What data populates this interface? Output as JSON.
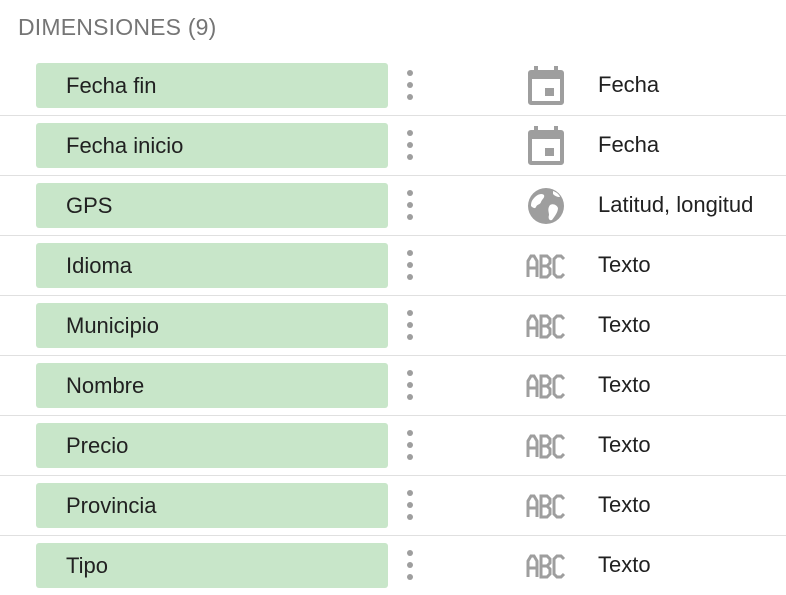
{
  "panel": {
    "title": "DIMENSIONES (9)"
  },
  "rows": [
    {
      "name": "Fecha fin",
      "type": "Fecha",
      "icon": "calendar-icon"
    },
    {
      "name": "Fecha inicio",
      "type": "Fecha",
      "icon": "calendar-icon"
    },
    {
      "name": "GPS",
      "type": "Latitud, longitud",
      "icon": "globe-icon"
    },
    {
      "name": "Idioma",
      "type": "Texto",
      "icon": "abc-text-icon"
    },
    {
      "name": "Municipio",
      "type": "Texto",
      "icon": "abc-text-icon"
    },
    {
      "name": "Nombre",
      "type": "Texto",
      "icon": "abc-text-icon"
    },
    {
      "name": "Precio",
      "type": "Texto",
      "icon": "abc-text-icon"
    },
    {
      "name": "Provincia",
      "type": "Texto",
      "icon": "abc-text-icon"
    },
    {
      "name": "Tipo",
      "type": "Texto",
      "icon": "abc-text-icon"
    }
  ],
  "colors": {
    "chip_background": "#c8e6c9",
    "icon_gray": "#9e9e9e",
    "header_gray": "#757575",
    "divider": "#e0e0e0"
  }
}
